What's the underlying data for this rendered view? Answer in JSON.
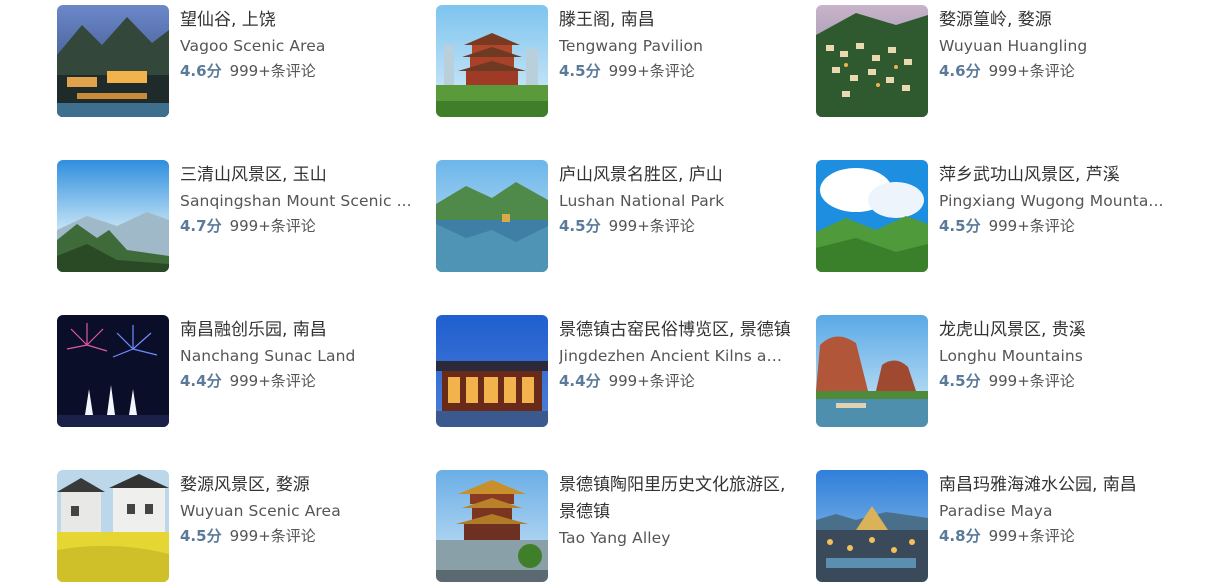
{
  "attractions": [
    {
      "name_cn": "望仙谷, 上饶",
      "name_en": "Vagoo Scenic Area",
      "score": "4.6分",
      "reviews": "999+条评论",
      "thumb": "mountain-village-night"
    },
    {
      "name_cn": "滕王阁, 南昌",
      "name_en": "Tengwang Pavilion",
      "score": "4.5分",
      "reviews": "999+条评论",
      "thumb": "pavilion"
    },
    {
      "name_cn": "婺源篁岭, 婺源",
      "name_en": "Wuyuan Huangling",
      "score": "4.6分",
      "reviews": "999+条评论",
      "thumb": "hillside-village"
    },
    {
      "name_cn": "三清山风景区, 玉山",
      "name_en": "Sanqingshan Mount Scenic ...",
      "score": "4.7分",
      "reviews": "999+条评论",
      "thumb": "misty-peaks"
    },
    {
      "name_cn": "庐山风景名胜区, 庐山",
      "name_en": "Lushan National Park",
      "score": "4.5分",
      "reviews": "999+条评论",
      "thumb": "lake-mountain"
    },
    {
      "name_cn": "萍乡武功山风景区, 芦溪",
      "name_en": "Pingxiang Wugong Mounta...",
      "score": "4.5分",
      "reviews": "999+条评论",
      "thumb": "grassy-ridge"
    },
    {
      "name_cn": "南昌融创乐园, 南昌",
      "name_en": "Nanchang Sunac Land",
      "score": "4.4分",
      "reviews": "999+条评论",
      "thumb": "fireworks"
    },
    {
      "name_cn": "景德镇古窑民俗博览区, 景德镇",
      "name_en": "Jingdezhen Ancient Kilns an...",
      "score": "4.4分",
      "reviews": "999+条评论",
      "thumb": "lit-building"
    },
    {
      "name_cn": "龙虎山风景区, 贵溪",
      "name_en": "Longhu Mountains",
      "score": "4.5分",
      "reviews": "999+条评论",
      "thumb": "red-cliffs-river"
    },
    {
      "name_cn": "婺源风景区, 婺源",
      "name_en": "Wuyuan Scenic Area",
      "score": "4.5分",
      "reviews": "999+条评论",
      "thumb": "canola-village"
    },
    {
      "name_cn": "景德镇陶阳里历史文化旅游区, 景德镇",
      "name_en": "Tao Yang Alley",
      "score": "",
      "reviews": "",
      "thumb": "tower-pagoda"
    },
    {
      "name_cn": "南昌玛雅海滩水公园, 南昌",
      "name_en": "Paradise Maya",
      "score": "4.8分",
      "reviews": "999+条评论",
      "thumb": "water-park"
    }
  ],
  "colors": {
    "score": "#5b7a99",
    "title": "#333333",
    "subtitle": "#555555"
  }
}
